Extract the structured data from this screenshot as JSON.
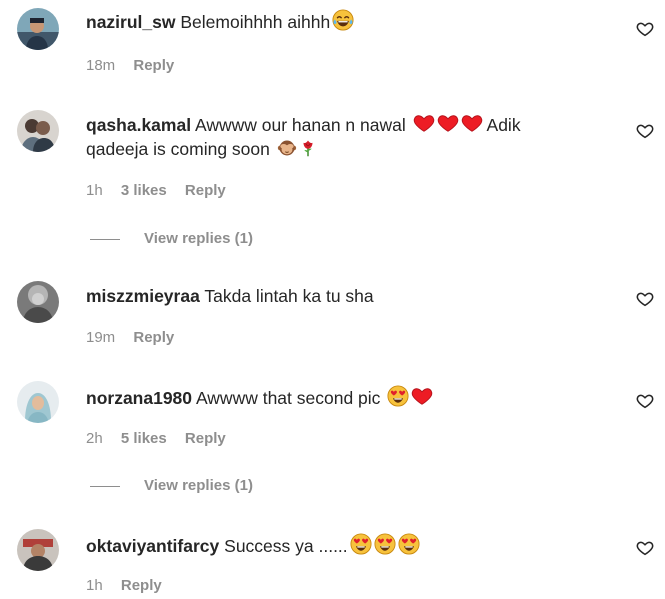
{
  "comments": [
    {
      "username": "nazirul_sw",
      "text": "Belemoihhhh aihhh",
      "emojis": [
        "laughing-tears"
      ],
      "time": "18m",
      "likes": "",
      "reply_label": "Reply"
    },
    {
      "username": "qasha.kamal",
      "text": "Awwww our hanan n nawal",
      "text2_a": "Adik",
      "text2_b": "qadeeja is coming soon",
      "emojis": [
        "red-heart",
        "red-heart",
        "red-heart"
      ],
      "emojis_line2": [
        "see-no-evil-monkey",
        "rose"
      ],
      "time": "1h",
      "likes": "3 likes",
      "reply_label": "Reply",
      "view_replies": "View replies (1)"
    },
    {
      "username": "miszzmieyraa",
      "text": "Takda lintah ka tu sha",
      "emojis": [],
      "time": "19m",
      "likes": "",
      "reply_label": "Reply"
    },
    {
      "username": "norzana1980",
      "text": "Awwww that second pic",
      "emojis": [
        "heart-eyes",
        "red-heart"
      ],
      "time": "2h",
      "likes": "5 likes",
      "reply_label": "Reply",
      "view_replies": "View replies (1)"
    },
    {
      "username": "oktaviyantifarcy",
      "text": "Success ya ......",
      "emojis": [
        "heart-eyes",
        "heart-eyes",
        "heart-eyes"
      ],
      "time": "1h",
      "likes": "",
      "reply_label": "Reply"
    }
  ],
  "colors": {
    "text": "#262626",
    "muted": "#8e8e8e",
    "heart": "#ed1c24",
    "emoji_face": "#f7c23c"
  }
}
